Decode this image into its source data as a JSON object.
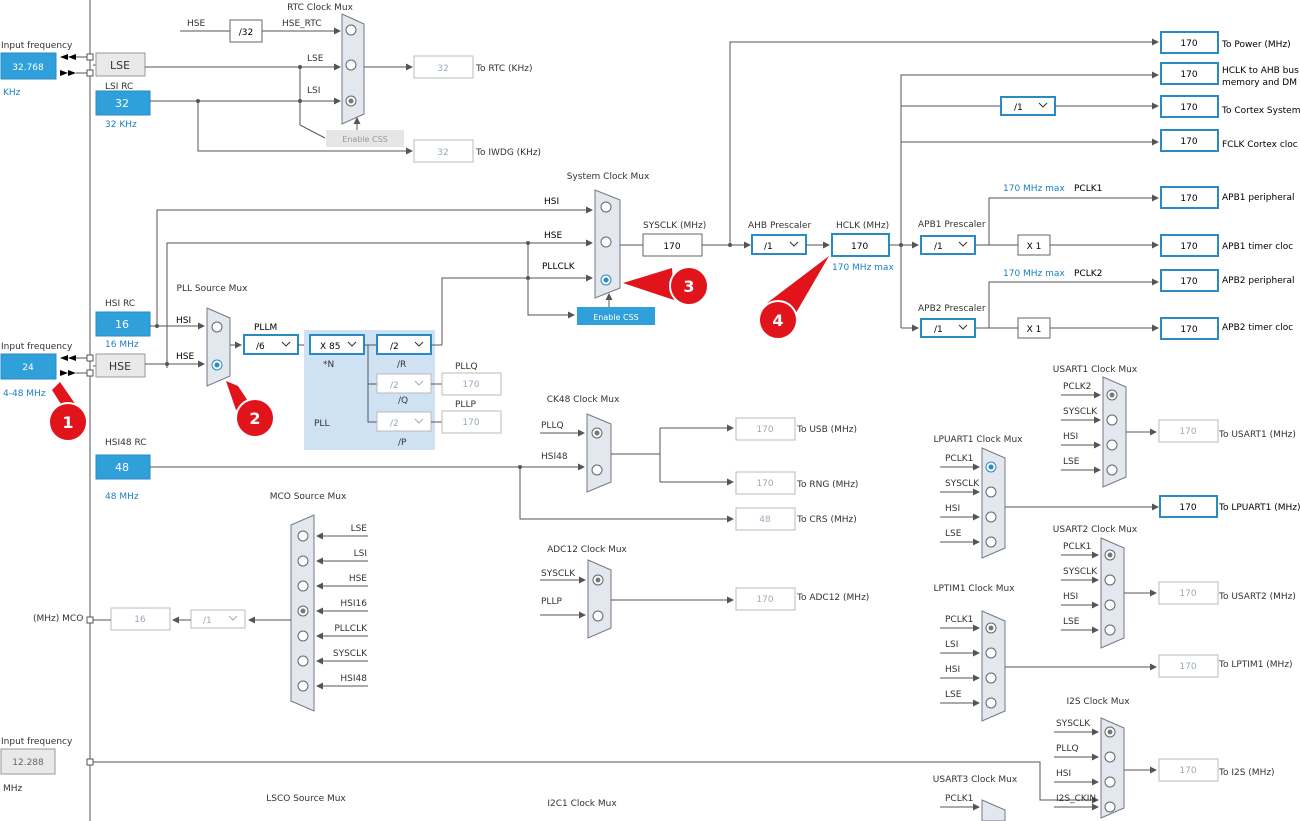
{
  "left": {
    "input_freq_label": "Input frequency",
    "lse_input": "32.768",
    "lse_unit": "KHz",
    "lse_label": "LSE",
    "lsirc_label": "LSI RC",
    "lsirc_value": "32",
    "lsirc_unit": "32 KHz",
    "hsirc_label": "HSI RC",
    "hsirc_value": "16",
    "hsirc_unit": "16 MHz",
    "hse_input": "24",
    "hse_range": "4-48 MHz",
    "hse_label": "HSE",
    "hsi48_label": "HSI48 RC",
    "hsi48_value": "48",
    "hsi48_unit": "48 MHz",
    "i2s_input": "12.288",
    "i2s_unit": "MHz",
    "mco_label": "(MHz) MCO",
    "mco_value": "16",
    "mco_div": "/1"
  },
  "rtc": {
    "hse": "HSE",
    "div32": "/32",
    "hse_rtc": "HSE_RTC",
    "title": "RTC Clock Mux",
    "lse": "LSE",
    "lsi": "LSI",
    "out": "32",
    "out_label": "To RTC (KHz)",
    "enable_css": "Enable CSS",
    "iwdg_out": "32",
    "iwdg_label": "To IWDG (KHz)"
  },
  "sysclk": {
    "title": "System Clock Mux",
    "hsi": "HSI",
    "hse": "HSE",
    "pllclk": "PLLCLK",
    "label": "SYSCLK (MHz)",
    "value": "170",
    "enable_css": "Enable CSS"
  },
  "pll": {
    "source_title": "PLL Source Mux",
    "hsi": "HSI",
    "hse": "HSE",
    "pllm_label": "PLLM",
    "pllm": "/6",
    "n": "X 85",
    "n_label": "*N",
    "r": "/2",
    "r_label": "/R",
    "q": "/2",
    "q_label": "/Q",
    "p": "/2",
    "p_label": "/P",
    "pllq_label": "PLLQ",
    "pllq_value": "170",
    "pllp_label": "PLLP",
    "pllp_value": "170",
    "pll_label": "PLL"
  },
  "ahb": {
    "prescaler_label": "AHB Prescaler",
    "prescaler": "/1",
    "hclk_label": "HCLK (MHz)",
    "hclk_value": "170",
    "hclk_max": "170 MHz max",
    "apb1_label": "APB1 Prescaler",
    "apb1": "/1",
    "apb1_max": "170 MHz max",
    "pclk1": "PCLK1",
    "apb2_label": "APB2 Prescaler",
    "apb2": "/1",
    "apb2_max": "170 MHz max",
    "pclk2": "PCLK2",
    "cortex_div": "/1",
    "x1a": "X 1",
    "x1b": "X 1"
  },
  "outputs": [
    {
      "value": "170",
      "label": "To Power (MHz)"
    },
    {
      "value": "170",
      "label": "HCLK to AHB bus",
      "label2": "memory and DM"
    },
    {
      "value": "170",
      "label": "To Cortex System"
    },
    {
      "value": "170",
      "label": "FCLK Cortex cloc"
    },
    {
      "value": "170",
      "label": "APB1 peripheral"
    },
    {
      "value": "170",
      "label": "APB1 timer cloc"
    },
    {
      "value": "170",
      "label": "APB2 peripheral"
    },
    {
      "value": "170",
      "label": "APB2 timer cloc"
    }
  ],
  "ck48": {
    "title": "CK48 Clock Mux",
    "pllq": "PLLQ",
    "hsi48": "HSI48",
    "usb": "170",
    "usb_label": "To USB (MHz)",
    "rng": "170",
    "rng_label": "To RNG (MHz)",
    "crs": "48",
    "crs_label": "To CRS (MHz)"
  },
  "adc": {
    "title": "ADC12 Clock Mux",
    "sysclk": "SYSCLK",
    "pllp": "PLLP",
    "out": "170",
    "out_label": "To ADC12 (MHz)"
  },
  "mco_mux": {
    "title": "MCO Source Mux",
    "inputs": [
      "LSE",
      "LSI",
      "HSE",
      "HSI16",
      "PLLCLK",
      "SYSCLK",
      "HSI48"
    ]
  },
  "usart1": {
    "title": "USART1 Clock Mux",
    "inputs": [
      "PCLK2",
      "SYSCLK",
      "HSI",
      "LSE"
    ],
    "out": "170",
    "out_label": "To USART1 (MHz)"
  },
  "lpuart1": {
    "title": "LPUART1 Clock Mux",
    "inputs": [
      "PCLK1",
      "SYSCLK",
      "HSI",
      "LSE"
    ],
    "out": "170",
    "out_label": "To LPUART1 (MHz)"
  },
  "usart2": {
    "title": "USART2 Clock Mux",
    "inputs": [
      "PCLK1",
      "SYSCLK",
      "HSI",
      "LSE"
    ],
    "out": "170",
    "out_label": "To USART2 (MHz)"
  },
  "lptim1": {
    "title": "LPTIM1 Clock Mux",
    "inputs": [
      "PCLK1",
      "LSI",
      "HSI",
      "LSE"
    ],
    "out": "170",
    "out_label": "To LPTIM1 (MHz)"
  },
  "i2s": {
    "title": "I2S Clock Mux",
    "inputs": [
      "SYSCLK",
      "PLLQ",
      "HSI",
      "I2S_CKIN"
    ],
    "out": "170",
    "out_label": "To I2S (MHz)"
  },
  "usart3": {
    "title": "USART3 Clock Mux",
    "inputs": [
      "PCLK1"
    ]
  },
  "lsco": {
    "title": "LSCO Source Mux"
  },
  "i2c1": {
    "title": "I2C1 Clock Mux"
  },
  "markers": [
    "1",
    "2",
    "3",
    "4"
  ],
  "colors": {
    "accent": "#2fa0da",
    "marker": "#e0141a",
    "mux": "#e3e8ee"
  }
}
